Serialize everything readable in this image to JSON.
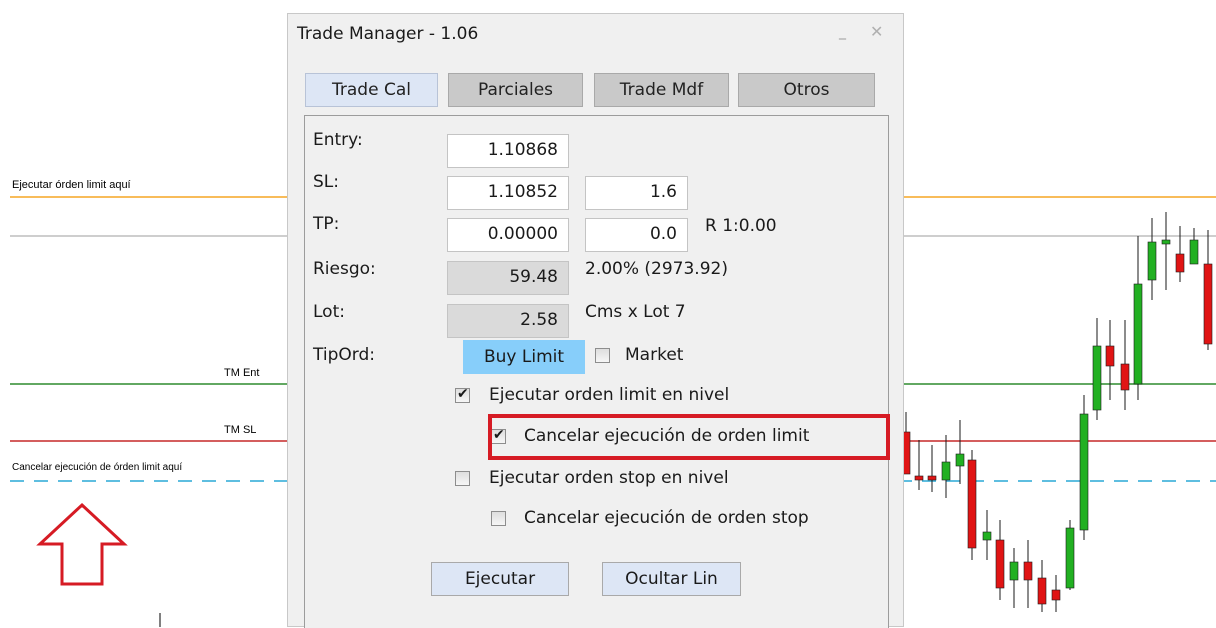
{
  "chart": {
    "labels": {
      "limit_line": "Ejecutar órden limit aquí",
      "entry_line": "TM Ent",
      "sl_line": "TM SL",
      "cancel_line": "Cancelar ejecución de órden limit aquí"
    },
    "colors": {
      "limit_line": "#f5a623",
      "entry_line": "#2e8b2e",
      "sl_line": "#c62828",
      "cancel_line": "#29a9d6",
      "upper_line": "#9e9e9e",
      "bull_candle": "#22b022",
      "bear_candle": "#e01414",
      "arrow": "#d61b24"
    }
  },
  "window": {
    "title": "Trade Manager - 1.06",
    "minimize_glyph": "_",
    "close_glyph": "✕"
  },
  "tabs": [
    {
      "label": "Trade Cal",
      "active": true
    },
    {
      "label": "Parciales",
      "active": false
    },
    {
      "label": "Trade Mdf",
      "active": false
    },
    {
      "label": "Otros",
      "active": false
    }
  ],
  "form": {
    "entry": {
      "label": "Entry:",
      "value": "1.10868"
    },
    "sl": {
      "label": "SL:",
      "value": "1.10852",
      "pips": "1.6"
    },
    "tp": {
      "label": "TP:",
      "value": "0.00000",
      "pips": "0.0",
      "ratio": "R 1:0.00"
    },
    "risk": {
      "label": "Riesgo:",
      "value": "59.48",
      "note": "2.00% (2973.92)"
    },
    "lot": {
      "label": "Lot:",
      "value": "2.58",
      "note": "Cms x Lot 7"
    },
    "order_type": {
      "label": "TipOrd:",
      "button": "Buy Limit",
      "market_label": "Market",
      "market_checked": false
    }
  },
  "options": {
    "limit_exec": {
      "label": "Ejecutar orden limit en nivel",
      "checked": true
    },
    "limit_cancel": {
      "label": "Cancelar ejecución de orden limit",
      "checked": true
    },
    "stop_exec": {
      "label": "Ejecutar orden stop en nivel",
      "checked": false
    },
    "stop_cancel": {
      "label": "Cancelar ejecución de orden stop",
      "checked": false
    }
  },
  "buttons": {
    "execute": "Ejecutar",
    "hide_lines": "Ocultar Lin"
  },
  "icons": {
    "check": "check-icon",
    "arrow": "up-arrow-icon"
  }
}
